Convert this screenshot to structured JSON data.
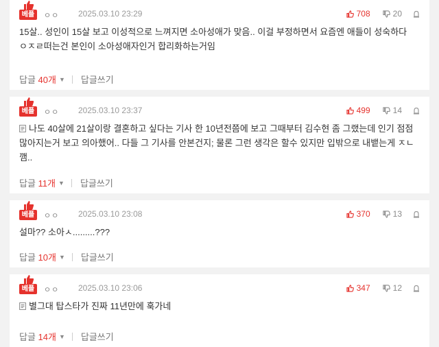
{
  "comments": [
    {
      "badge": "베플",
      "nick": "ㅇㅇ",
      "date": "2025.03.10 23:29",
      "up": "708",
      "down": "20",
      "has_doc_icon": false,
      "text": "15살.. 성인이 15살 보고 이성적으로 느껴지면 소아성애가 맞음.. 이걸 부정하면서 요즘엔 애들이 성숙하다 ㅇㅈㄹ떠는건 본인이 소아성애자인거 합리화하는거임",
      "reply_label": "답글",
      "reply_count": "40개",
      "write_label": "답글쓰기"
    },
    {
      "badge": "베플",
      "nick": "ㅇㅇ",
      "date": "2025.03.10 23:37",
      "up": "499",
      "down": "14",
      "has_doc_icon": true,
      "text": "나도 40살에 21살이랑 결혼하고 싶다는 기사 한 10년전쯤에 보고 그때부터 김수현 좀 그랬는데 인기 점점 많아지는거 보고 의아했어.. 다들 그 기사를 안본건지; 물론 그런 생각은 할수 있지만 입밖으로 내뱉는게 ㅈㄴ 깸..",
      "reply_label": "답글",
      "reply_count": "11개",
      "write_label": "답글쓰기"
    },
    {
      "badge": "베플",
      "nick": "ㅇㅇ",
      "date": "2025.03.10 23:08",
      "up": "370",
      "down": "13",
      "has_doc_icon": false,
      "text": "설마?? 소아ㅅ.........???",
      "reply_label": "답글",
      "reply_count": "10개",
      "write_label": "답글쓰기"
    },
    {
      "badge": "베플",
      "nick": "ㅇㅇ",
      "date": "2025.03.10 23:06",
      "up": "347",
      "down": "12",
      "has_doc_icon": true,
      "text": "별그대 탑스타가 진짜 11년만에 훅가네",
      "reply_label": "답글",
      "reply_count": "14개",
      "write_label": "답글쓰기"
    }
  ],
  "colors": {
    "accent": "#e5322d",
    "muted": "#9a9a9a",
    "background": "#f2f2f2",
    "card": "#ffffff"
  },
  "icons": {
    "badge": "thumbs-up-icon",
    "vote_up": "thumbs-up-icon",
    "vote_down": "thumbs-down-icon",
    "report": "siren-icon",
    "doc": "document-icon",
    "caret": "caret-down-icon"
  }
}
